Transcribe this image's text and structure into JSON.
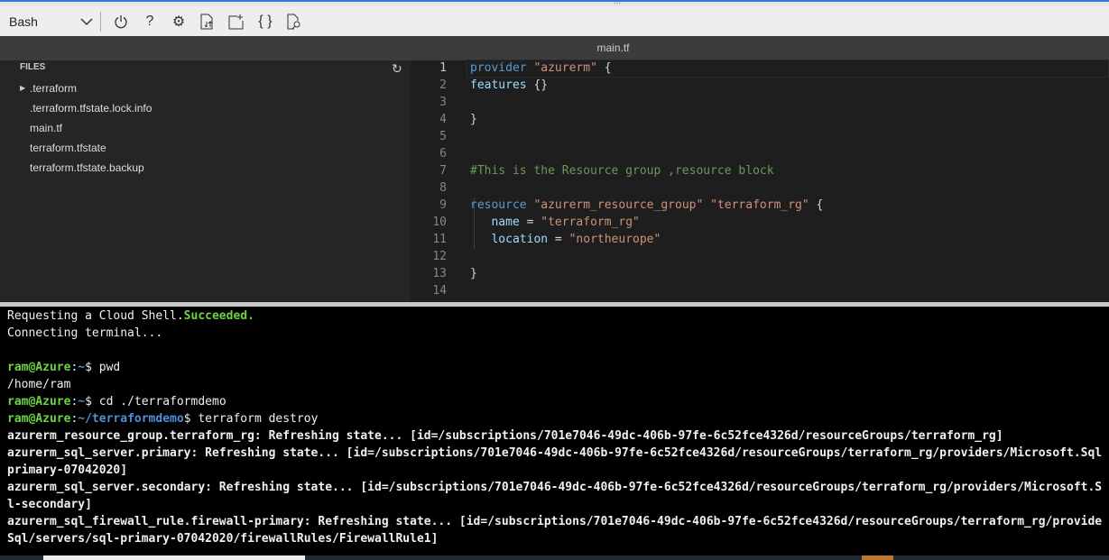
{
  "toolbar": {
    "shell": "Bash",
    "grip": "...",
    "icons": [
      "power-icon",
      "help-icon",
      "gear-icon",
      "upload-download-icon",
      "new-session-icon",
      "braces-icon",
      "web-preview-icon"
    ]
  },
  "editor_title": "main.tf",
  "files": {
    "title": "FILES",
    "items": [
      ".terraform",
      ".terraform.tfstate.lock.info",
      "main.tf",
      "terraform.tfstate",
      "terraform.tfstate.backup"
    ]
  },
  "code": {
    "lines": [
      [
        {
          "t": "provider ",
          "c": "kw"
        },
        {
          "t": "\"azurerm\"",
          "c": "st"
        },
        {
          "t": " {",
          "c": ""
        }
      ],
      [
        {
          "t": "features",
          "c": "at"
        },
        {
          "t": " {}",
          "c": ""
        }
      ],
      [],
      [
        {
          "t": "}",
          "c": ""
        }
      ],
      [],
      [],
      [
        {
          "t": "#This is the Resource group ,resource block",
          "c": "cm"
        }
      ],
      [],
      [
        {
          "t": "resource ",
          "c": "kw"
        },
        {
          "t": "\"azurerm_resource_group\"",
          "c": "st"
        },
        {
          "t": " ",
          "c": ""
        },
        {
          "t": "\"terraform_rg\"",
          "c": "st"
        },
        {
          "t": " {",
          "c": ""
        }
      ],
      [
        {
          "t": "   ",
          "c": ""
        },
        {
          "t": "name",
          "c": "at"
        },
        {
          "t": " = ",
          "c": ""
        },
        {
          "t": "\"terraform_rg\"",
          "c": "st"
        }
      ],
      [
        {
          "t": "   ",
          "c": ""
        },
        {
          "t": "location",
          "c": "at"
        },
        {
          "t": " = ",
          "c": ""
        },
        {
          "t": "\"northeurope\"",
          "c": "st"
        }
      ],
      [],
      [
        {
          "t": "}",
          "c": ""
        }
      ],
      []
    ]
  },
  "terminal": {
    "lines": [
      [
        {
          "t": "Requesting a Cloud Shell.",
          "c": ""
        },
        {
          "t": "Succeeded.",
          "c": "g"
        }
      ],
      [
        {
          "t": "Connecting terminal...",
          "c": ""
        }
      ],
      [],
      [
        {
          "t": "ram@Azure",
          "c": "g"
        },
        {
          "t": ":",
          "c": ""
        },
        {
          "t": "~",
          "c": "b"
        },
        {
          "t": "$ pwd",
          "c": ""
        }
      ],
      [
        {
          "t": "/home/ram",
          "c": ""
        }
      ],
      [
        {
          "t": "ram@Azure",
          "c": "g"
        },
        {
          "t": ":",
          "c": ""
        },
        {
          "t": "~",
          "c": "b"
        },
        {
          "t": "$ cd ./terraformdemo",
          "c": ""
        }
      ],
      [
        {
          "t": "ram@Azure",
          "c": "g"
        },
        {
          "t": ":",
          "c": ""
        },
        {
          "t": "~/terraformdemo",
          "c": "b"
        },
        {
          "t": "$ terraform destroy",
          "c": ""
        }
      ],
      [
        {
          "t": "azurerm_resource_group.terraform_rg: Refreshing state... [id=/subscriptions/701e7046-49dc-406b-97fe-6c52fce4326d/resourceGroups/terraform_rg]",
          "c": "w"
        }
      ],
      [
        {
          "t": "azurerm_sql_server.primary: Refreshing state... [id=/subscriptions/701e7046-49dc-406b-97fe-6c52fce4326d/resourceGroups/terraform_rg/providers/Microsoft.Sql/servers/sql-",
          "c": "w"
        }
      ],
      [
        {
          "t": "primary-07042020]",
          "c": "w"
        }
      ],
      [
        {
          "t": "azurerm_sql_server.secondary: Refreshing state... [id=/subscriptions/701e7046-49dc-406b-97fe-6c52fce4326d/resourceGroups/terraform_rg/providers/Microsoft.Sql/servers/sq",
          "c": "w"
        }
      ],
      [
        {
          "t": "l-secondary]",
          "c": "w"
        }
      ],
      [
        {
          "t": "azurerm_sql_firewall_rule.firewall-primary: Refreshing state... [id=/subscriptions/701e7046-49dc-406b-97fe-6c52fce4326d/resourceGroups/terraform_rg/providers/Microsoft.",
          "c": "w"
        }
      ],
      [
        {
          "t": "Sql/servers/sql-primary-07042020/firewallRules/FirewallRule1]",
          "c": "w"
        }
      ]
    ]
  }
}
